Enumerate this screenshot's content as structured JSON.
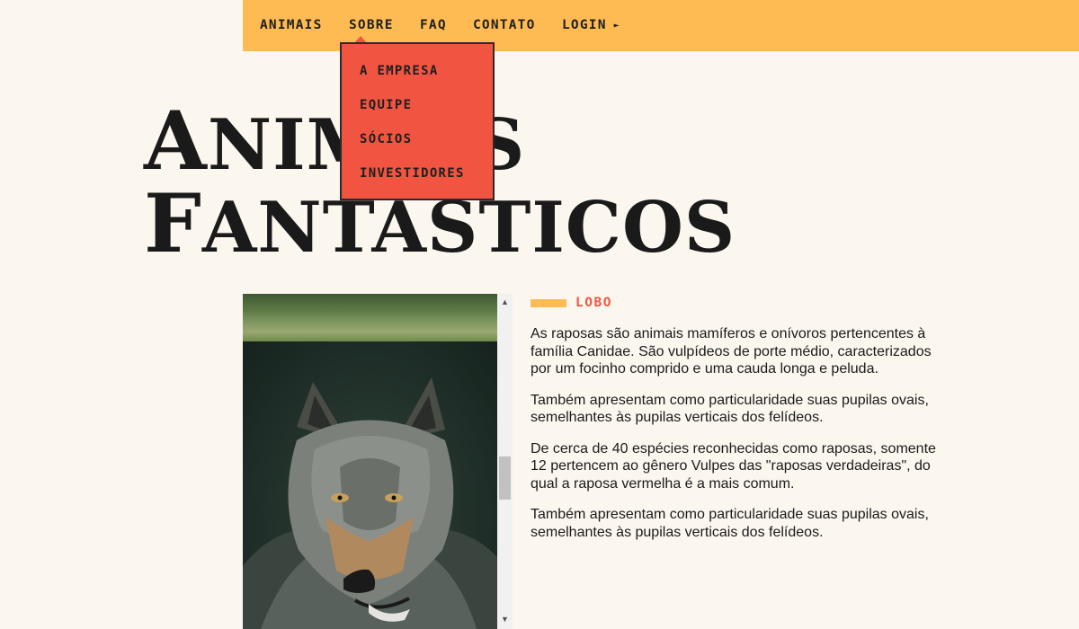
{
  "nav": {
    "items": [
      {
        "label": "ANIMAIS"
      },
      {
        "label": "SOBRE"
      },
      {
        "label": "FAQ"
      },
      {
        "label": "CONTATO"
      },
      {
        "label": "LOGIN"
      }
    ],
    "login_arrow": "►"
  },
  "dropdown": {
    "items": [
      {
        "label": "A EMPRESA"
      },
      {
        "label": "EQUIPE"
      },
      {
        "label": "SÓCIOS"
      },
      {
        "label": "INVESTIDORES"
      }
    ]
  },
  "hero": {
    "line1_cap": "A",
    "line1_rest": "NIMAIS",
    "line2_cap": "F",
    "line2_rest": "ANTÁSTICOS"
  },
  "section": {
    "label": "LOBO",
    "paragraphs": [
      "As raposas são animais mamíferos e onívoros pertencentes à família Canidae. São vulpídeos de porte médio, caracterizados por um focinho comprido e uma cauda longa e peluda.",
      "Também apresentam como particularidade suas pupilas ovais, semelhantes às pupilas verticais dos felídeos.",
      "De cerca de 40 espécies reconhecidas como raposas, somente 12 pertencem ao gênero Vulpes das \"raposas verdadeiras\", do qual a raposa vermelha é a mais comum.",
      "Também apresentam como particularidade suas pupilas ovais, semelhantes às pupilas verticais dos felídeos."
    ]
  },
  "scrollbar": {
    "up_arrow": "▲",
    "down_arrow": "▼"
  },
  "colors": {
    "nav_bg": "#ffbb53",
    "dropdown_bg": "#f15542",
    "accent": "#f15542",
    "page_bg": "#fbf6ee"
  }
}
